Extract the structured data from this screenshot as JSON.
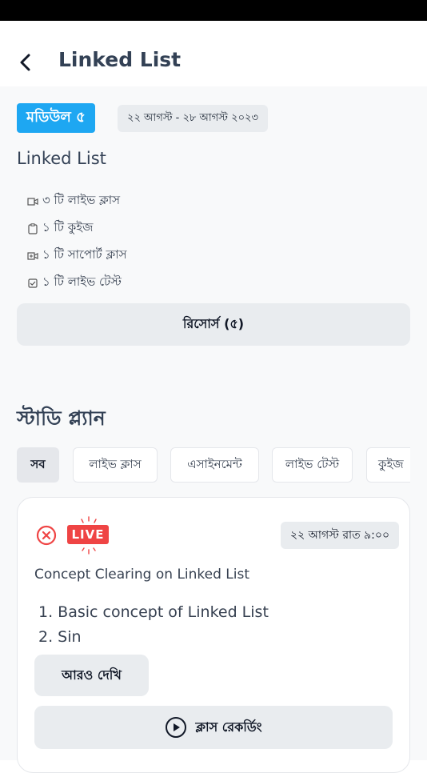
{
  "header": {
    "title": "Linked List"
  },
  "module": {
    "badge": "মডিউল ৫",
    "date_range": "২২ আগস্ট - ২৮ আগস্ট ২০২৩",
    "title": "Linked List",
    "features": [
      {
        "icon": "video-camera-icon",
        "text": "৩ টি লাইভ ক্লাস"
      },
      {
        "icon": "clipboard-icon",
        "text": "১ টি কুইজ"
      },
      {
        "icon": "support-class-icon",
        "text": "১ টি সাপোর্ট ক্লাস"
      },
      {
        "icon": "checkbox-icon",
        "text": "১ টি লাইভ টেস্ট"
      }
    ],
    "resources_button": "রিসোর্স (৫)"
  },
  "study_plan": {
    "title": "স্টাডি প্ল্যান",
    "tabs": [
      "সব",
      "লাইভ ক্লাস",
      "এসাইনমেন্ট",
      "লাইভ টেস্ট",
      "কুইজ"
    ],
    "active_tab": "সব"
  },
  "class_card": {
    "live_badge": "LIVE",
    "date_time": "২২ আগস্ট রাত ৯:০০",
    "title": "Concept Clearing on Linked List",
    "topics": [
      "1. Basic concept of Linked List",
      "2. Sin"
    ],
    "more_button": "আরও দেখি",
    "recording_button": "ক্লাস রেকর্ডিং"
  },
  "colors": {
    "accent": "#1ea7f2",
    "live_red": "#ef4444",
    "background": "#f8f9fa"
  }
}
